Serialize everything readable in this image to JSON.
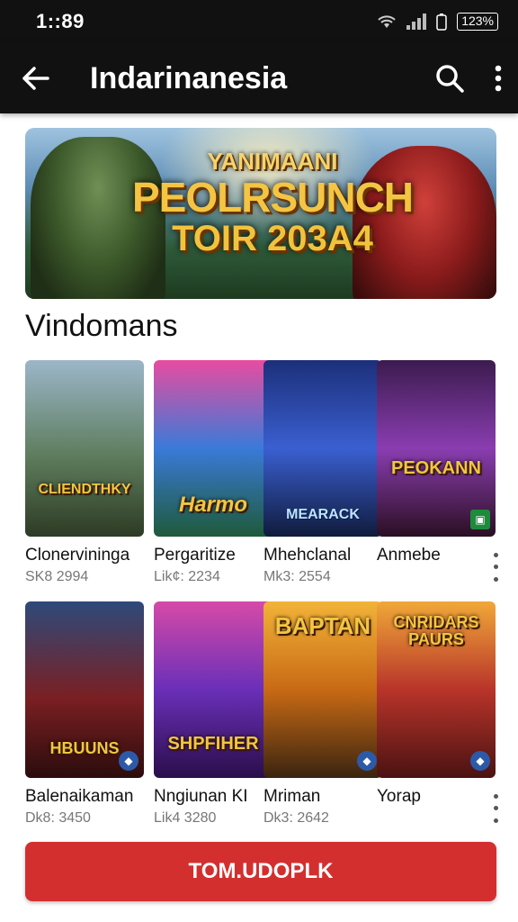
{
  "status": {
    "time": "1::89",
    "battery": "123%"
  },
  "appbar": {
    "title": "Indarinanesia",
    "back_icon": "back-arrow-icon",
    "search_icon": "search-icon",
    "menu_icon": "more-vert-icon"
  },
  "banner": {
    "line1": "YANIMAANI",
    "line2": "PEOLRSUNCH",
    "line3": "TOIR 203A4"
  },
  "section": {
    "title": "Vindomans"
  },
  "cards": [
    {
      "name": "Clonervininga",
      "meta": "SK8 2994",
      "art": "CLIENDTHKY",
      "corner": "",
      "bg": "linear-gradient(180deg,#9cb6c9,#5d7c5c 55%,#2d3b24)"
    },
    {
      "name": "Pergaritize",
      "meta": "Lik¢: 2234",
      "art": "Harmo",
      "corner": "",
      "bg": "linear-gradient(180deg,#e84ca0,#3a7ad8 50%,#1e5a3a)"
    },
    {
      "name": "Mhehclanal",
      "meta": "Mk3: 2554",
      "art": "MEARACK",
      "corner": "",
      "bg": "linear-gradient(180deg,#1c2f7a,#3a5fd0 50%,#101b3c)"
    },
    {
      "name": "Anmebe",
      "meta": "",
      "art": "PEOKANN",
      "corner": "▣",
      "bg": "linear-gradient(180deg,#3b1b4e,#8a3db0 50%,#2a0f22)"
    },
    {
      "name": "Balenaikaman",
      "meta": "Dk8: 3450",
      "art": "HBUUNS",
      "corner": "◆",
      "bg": "linear-gradient(180deg,#2d4a7a,#7a1f22 55%,#2b0c0c)"
    },
    {
      "name": "Nngiunan KI",
      "meta": "Lik4 3280",
      "art": "SHPFIHER",
      "corner": "",
      "bg": "linear-gradient(180deg,#d64aa8,#6a2fb8 50%,#2a0e4a)"
    },
    {
      "name": "Mriman",
      "meta": "Dk3: 2642",
      "art": "BAPTAN",
      "corner": "◆",
      "bg": "linear-gradient(180deg,#f2b338,#c86a15 50%,#3a2410)"
    },
    {
      "name": "Yorap",
      "meta": "",
      "art": "CNRIDARS PAURS",
      "corner": "◆",
      "bg": "linear-gradient(180deg,#f0a838,#b8342a 50%,#4a1212)"
    }
  ],
  "cta": {
    "label": "TOM.UDOPLK"
  }
}
